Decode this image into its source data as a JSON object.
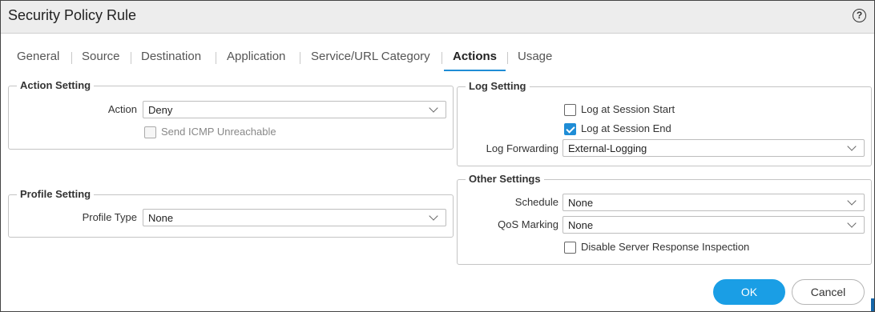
{
  "dialog": {
    "title": "Security Policy Rule",
    "help_icon": "?"
  },
  "tabs": [
    {
      "label": "General"
    },
    {
      "label": "Source"
    },
    {
      "label": "Destination"
    },
    {
      "label": "Application"
    },
    {
      "label": "Service/URL Category"
    },
    {
      "label": "Actions",
      "active": true
    },
    {
      "label": "Usage"
    }
  ],
  "action_setting": {
    "legend": "Action Setting",
    "action_label": "Action",
    "action_value": "Deny",
    "send_icmp_label": "Send ICMP Unreachable",
    "send_icmp_checked": false
  },
  "profile_setting": {
    "legend": "Profile Setting",
    "profile_type_label": "Profile Type",
    "profile_type_value": "None"
  },
  "log_setting": {
    "legend": "Log Setting",
    "log_start_label": "Log at Session Start",
    "log_start_checked": false,
    "log_end_label": "Log at Session End",
    "log_end_checked": true,
    "log_forwarding_label": "Log Forwarding",
    "log_forwarding_value": "External-Logging"
  },
  "other_settings": {
    "legend": "Other Settings",
    "schedule_label": "Schedule",
    "schedule_value": "None",
    "qos_label": "QoS Marking",
    "qos_value": "None",
    "disable_sri_label": "Disable Server Response Inspection",
    "disable_sri_checked": false
  },
  "buttons": {
    "ok": "OK",
    "cancel": "Cancel"
  },
  "colors": {
    "accent": "#1a9ee5",
    "title_bar": "#ededed"
  }
}
